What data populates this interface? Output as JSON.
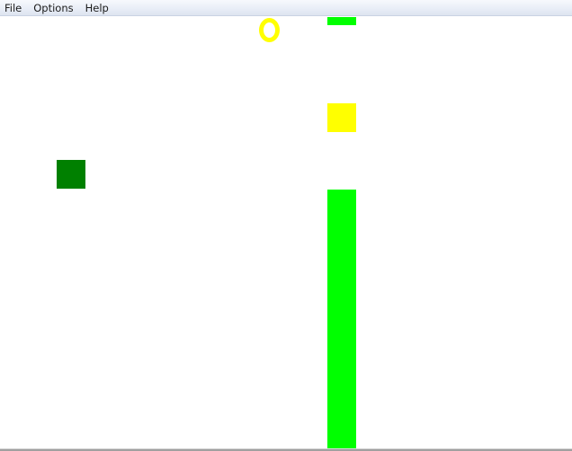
{
  "menu": {
    "items": [
      {
        "label": "File"
      },
      {
        "label": "Options"
      },
      {
        "label": "Help"
      }
    ]
  },
  "game": {
    "colors": {
      "pipe": "#00ff00",
      "bonus": "#ffff00",
      "player": "#008000",
      "ring": "#ffff00",
      "background": "#ffffff"
    },
    "icons": {
      "score_ring": "yellow-ring-icon"
    }
  }
}
